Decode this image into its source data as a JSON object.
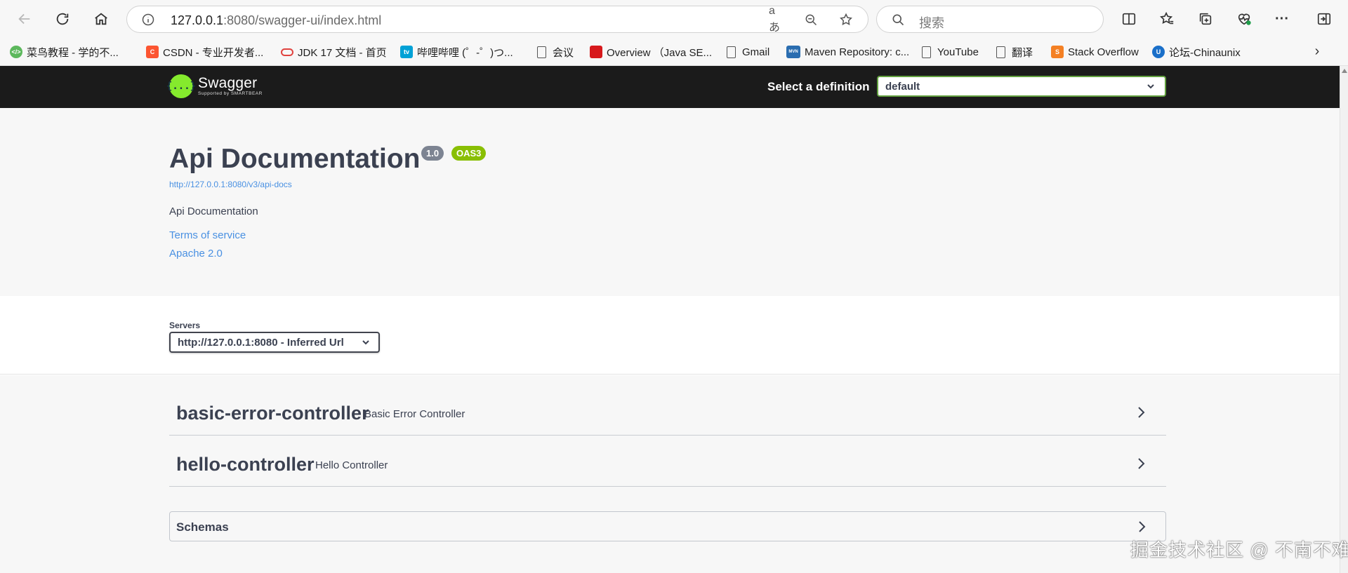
{
  "browser": {
    "address": {
      "host": "127.0.0.1",
      "rest": ":8080/swagger-ui/index.html"
    },
    "search_placeholder": "搜索",
    "read_aloud_glyph": "aあ"
  },
  "bookmarks": [
    {
      "label": "菜鸟教程 - 学的不...",
      "icon": "runoob-icon",
      "color": "#5cb85c",
      "glyph": "</>"
    },
    {
      "label": "CSDN - 专业开发者...",
      "icon": "csdn-icon",
      "color": "#fc5531",
      "glyph": "C"
    },
    {
      "label": "JDK 17 文档 - 首页",
      "icon": "oracle-icon",
      "color": "#e0433f",
      "glyph": ""
    },
    {
      "label": "哔哩哔哩 (゜-゜)つ...",
      "icon": "bilibili-icon",
      "color": "#00a1d6",
      "glyph": "tv"
    },
    {
      "label": "会议",
      "icon": "page-icon",
      "color": "",
      "glyph": ""
    },
    {
      "label": "Overview （Java SE...",
      "icon": "oracle-red-icon",
      "color": "#d7191c",
      "glyph": ""
    },
    {
      "label": "Gmail",
      "icon": "page-icon",
      "color": "",
      "glyph": ""
    },
    {
      "label": "Maven Repository: c...",
      "icon": "mvn-icon",
      "color": "#2a6db0",
      "glyph": "MVN"
    },
    {
      "label": "YouTube",
      "icon": "page-icon",
      "color": "",
      "glyph": ""
    },
    {
      "label": "翻译",
      "icon": "page-icon",
      "color": "",
      "glyph": ""
    },
    {
      "label": "Stack Overflow",
      "icon": "stackoverflow-icon",
      "color": "#f48024",
      "glyph": "S"
    },
    {
      "label": "论坛-Chinaunix",
      "icon": "chinaunix-icon",
      "color": "#1a6fc9",
      "glyph": "U"
    }
  ],
  "swagger": {
    "logo_text": "Swagger",
    "logo_sub": "Supported by SMARTBEAR",
    "logo_glyph": "{...}",
    "definition_label": "Select a definition",
    "definition_value": "default",
    "title": "Api Documentation",
    "version_badge": "1.0",
    "oas_badge": "OAS3",
    "api_docs_url": "http://127.0.0.1:8080/v3/api-docs",
    "description": "Api Documentation",
    "terms_link": "Terms of service",
    "license_link": "Apache 2.0",
    "servers_label": "Servers",
    "server_value": "http://127.0.0.1:8080 - Inferred Url",
    "tags": [
      {
        "name": "basic-error-controller",
        "description": "Basic Error Controller"
      },
      {
        "name": "hello-controller",
        "description": "Hello Controller"
      }
    ],
    "schemas_label": "Schemas"
  },
  "watermark": "掘金技术社区 @ 不南不难",
  "colors": {
    "swagger_green": "#85ea2d",
    "topbar_bg": "#1b1b1b",
    "version_badge": "#7d8492",
    "oas_badge": "#89bf04",
    "link": "#4990e2"
  }
}
